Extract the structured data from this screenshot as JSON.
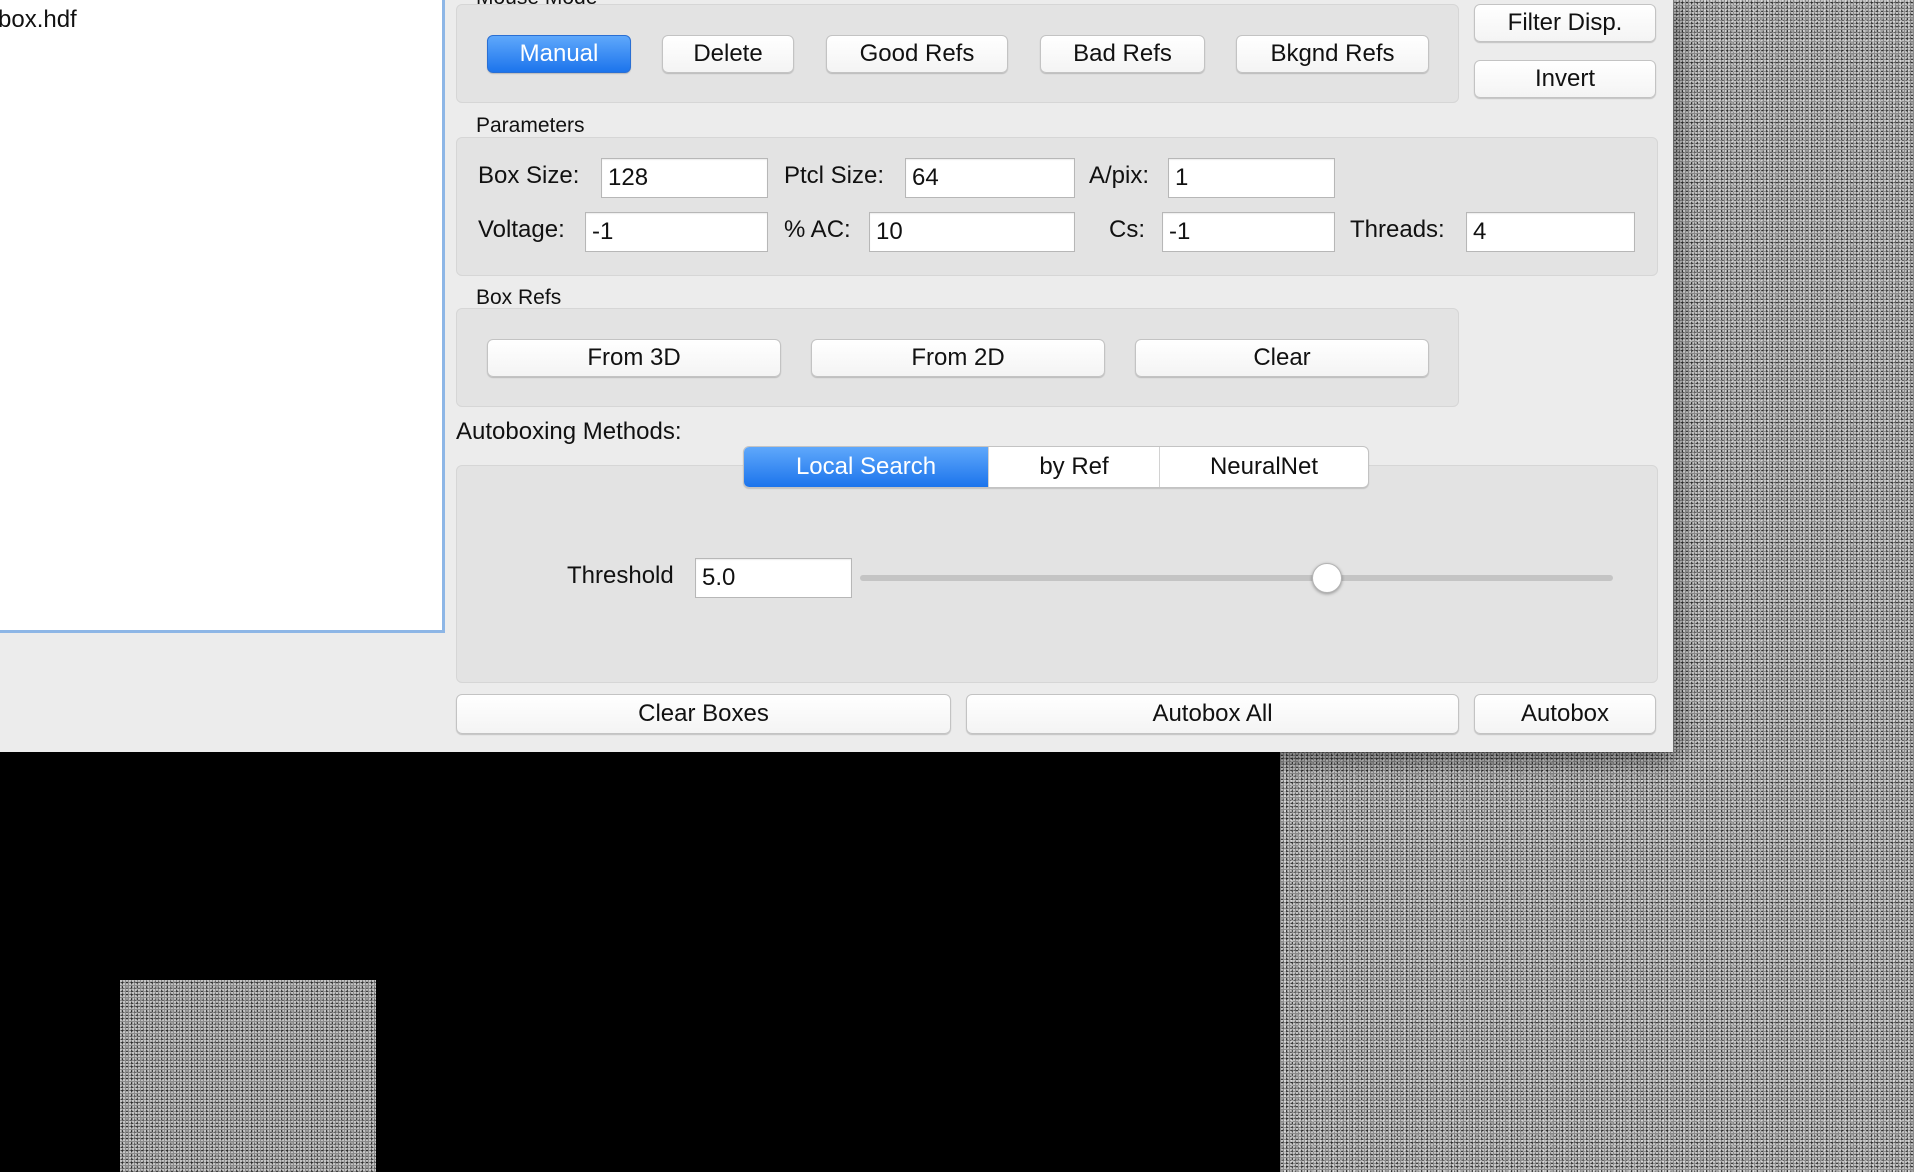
{
  "file_list": {
    "items": [
      "box.hdf"
    ]
  },
  "mouse_mode": {
    "title": "Mouse Mode",
    "buttons": [
      "Manual",
      "Delete",
      "Good Refs",
      "Bad Refs",
      "Bkgnd Refs"
    ],
    "active": "Manual"
  },
  "side_buttons": {
    "filter": "Filter Disp.",
    "invert": "Invert"
  },
  "parameters": {
    "title": "Parameters",
    "box_size": {
      "label": "Box Size:",
      "value": "128"
    },
    "ptcl_size": {
      "label": "Ptcl Size:",
      "value": "64"
    },
    "apix": {
      "label": "A/pix:",
      "value": "1"
    },
    "voltage": {
      "label": "Voltage:",
      "value": "-1"
    },
    "ac": {
      "label": "% AC:",
      "value": "10"
    },
    "cs": {
      "label": "Cs:",
      "value": "-1"
    },
    "threads": {
      "label": "Threads:",
      "value": "4"
    }
  },
  "box_refs": {
    "title": "Box Refs",
    "from3d": "From 3D",
    "from2d": "From 2D",
    "clear": "Clear"
  },
  "autoboxing": {
    "title": "Autoboxing Methods:",
    "tabs": [
      "Local Search",
      "by Ref",
      "NeuralNet"
    ],
    "active_tab": "Local Search",
    "threshold_label": "Threshold",
    "threshold_value": "5.0",
    "threshold_slider_fraction": 0.62
  },
  "bottom": {
    "clear_boxes": "Clear Boxes",
    "autobox_all": "Autobox All",
    "autobox": "Autobox"
  },
  "colors": {
    "accent": "#1c74ec",
    "window_bg": "#ececec"
  }
}
